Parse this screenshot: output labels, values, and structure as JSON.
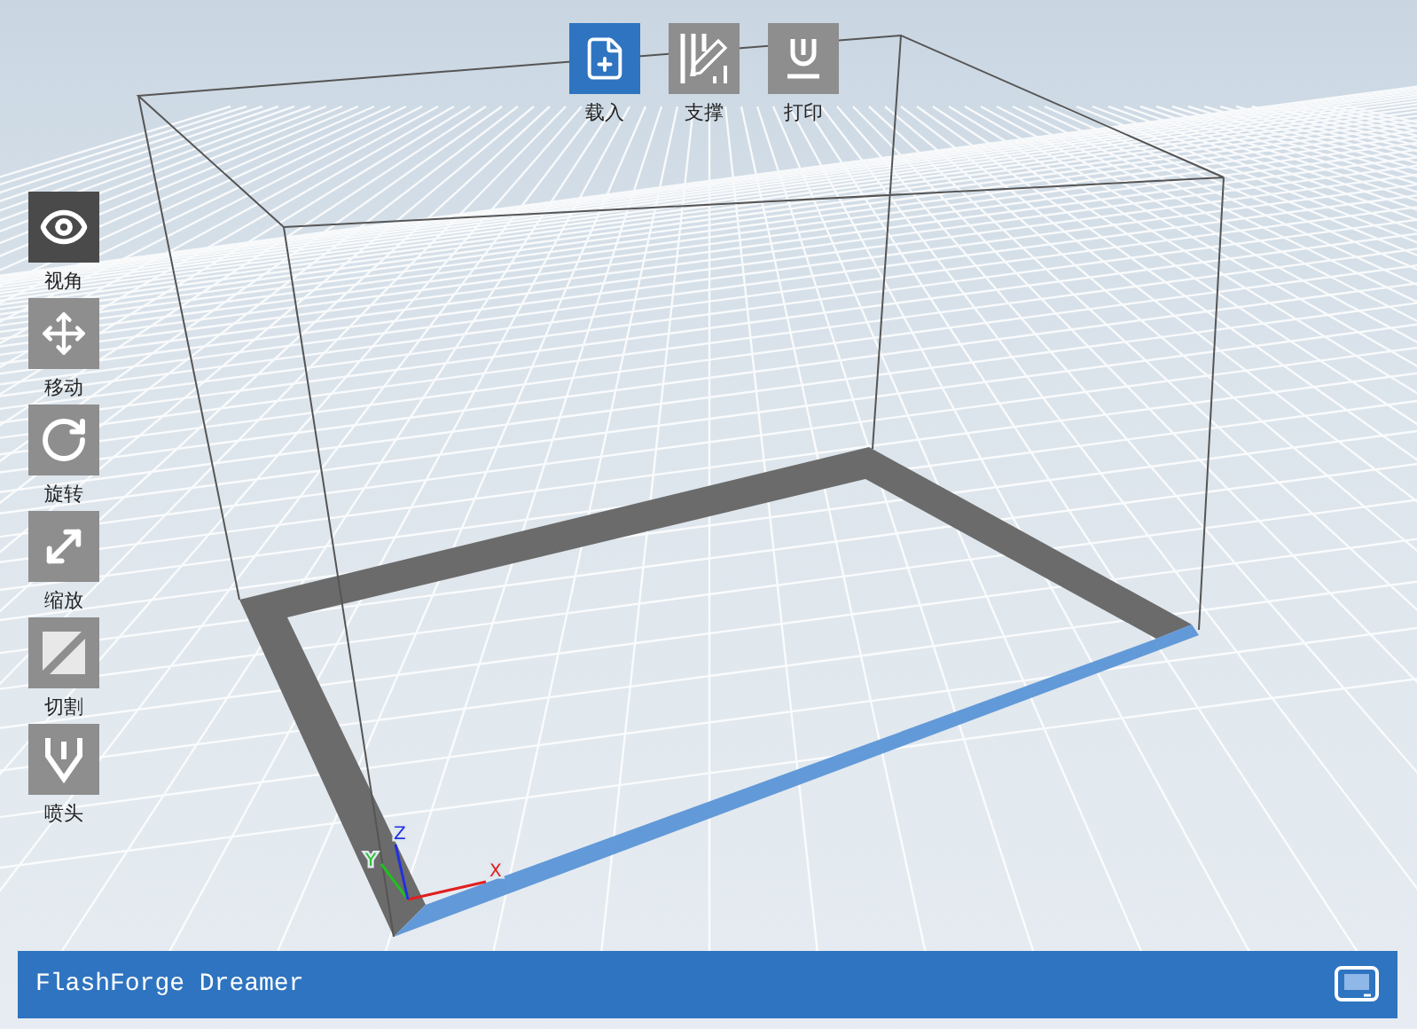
{
  "top_toolbar": [
    {
      "label": "载入",
      "selected": true
    },
    {
      "label": "支撑",
      "selected": false
    },
    {
      "label": "打印",
      "selected": false
    }
  ],
  "left_toolbar": [
    {
      "label": "视角",
      "selected": true
    },
    {
      "label": "移动",
      "selected": false
    },
    {
      "label": "旋转",
      "selected": false
    },
    {
      "label": "缩放",
      "selected": false
    },
    {
      "label": "切割",
      "selected": false
    },
    {
      "label": "喷头",
      "selected": false
    }
  ],
  "scene": {
    "axis_labels": [
      "X",
      "Y",
      "Z"
    ]
  },
  "status_bar": {
    "title": "FlashForge Dreamer"
  }
}
